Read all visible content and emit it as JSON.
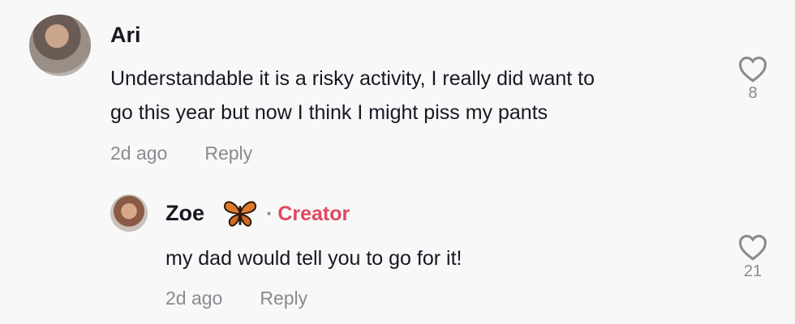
{
  "comments": [
    {
      "username": "Ari",
      "text_line1": "Understandable it is a risky activity, I really did want to",
      "text_line2": "go this year but now I think I might piss my pants",
      "time": "2d ago",
      "reply_label": "Reply",
      "likes": "8"
    }
  ],
  "reply": {
    "username": "Zoe",
    "emoji": "butterfly-emoji",
    "separator": "·",
    "badge": "Creator",
    "text": "my dad would tell you to go for it!",
    "time": "2d ago",
    "reply_label": "Reply",
    "likes": "21"
  },
  "colors": {
    "background": "#f8f8f8",
    "text": "#161823",
    "muted": "#8a8b91",
    "creator": "#e0485f"
  }
}
